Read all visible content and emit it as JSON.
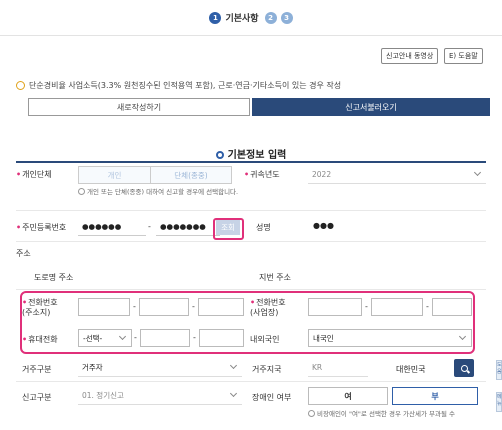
{
  "steps": {
    "step1_num": "1",
    "step1_label": "기본사항",
    "step2_num": "2",
    "step3_num": "3"
  },
  "guide": {
    "video_btn": "신고안내 동영상",
    "help_btn": "E) 도움말"
  },
  "notice": {
    "text": "단순경비율 사업소득(3.3% 원천징수된 인적용역 포함), 근로·연금·기타소득이 있는 경우 작성"
  },
  "actions": {
    "new_btn": "새로작성하기",
    "load_btn": "신고서불러오기"
  },
  "section": {
    "title": "기본정보 입력"
  },
  "form": {
    "individual_label": "개인단체",
    "individual_opt": "개인",
    "group_opt": "단체(종중)",
    "individual_hint": "개인 또는 단체(종중) 대하여 신고할 경우에 선택합니다.",
    "year_label": "귀속년도",
    "year_value": "2022",
    "rrn_label": "주민등록번호",
    "rrn_front": "●●●●●●",
    "rrn_dash": "-",
    "rrn_back": "●●●●●●●",
    "rrn_check_btn": "조회",
    "name_label": "성명",
    "name_value": "●●●",
    "address_label": "주소",
    "road_address_label": "도로명 주소",
    "lot_address_label": "지번 주소",
    "phone_home_label": "전화번호",
    "phone_home_sub": "(주소지)",
    "phone_work_label": "전화번호",
    "phone_work_sub": "(사업장)",
    "mobile_label": "휴대전화",
    "mobile_select": "-선택-",
    "nationality_label": "내외국인",
    "nationality_value": "내국인",
    "residency_label": "거주구분",
    "residency_value": "거주자",
    "residence_country_label": "거주지국",
    "residence_country_code": "KR",
    "residence_country_name": "대한민국",
    "filing_type_label": "신고구분",
    "filing_type_value": "01. 정기신고",
    "disability_label": "장애인 여부",
    "disability_yes": "여",
    "disability_no": "부",
    "disability_hint": "비장애인이 \"여\"로 선택한 경우 가산세가 부과될 수"
  },
  "side_tabs": {
    "tab1": "도움",
    "tab2": "메뉴"
  },
  "colors": {
    "primary": "#2a4a7a",
    "step_active": "#2f5fa8",
    "highlight": "#e0307a",
    "notice_icon": "#e0a21a"
  }
}
